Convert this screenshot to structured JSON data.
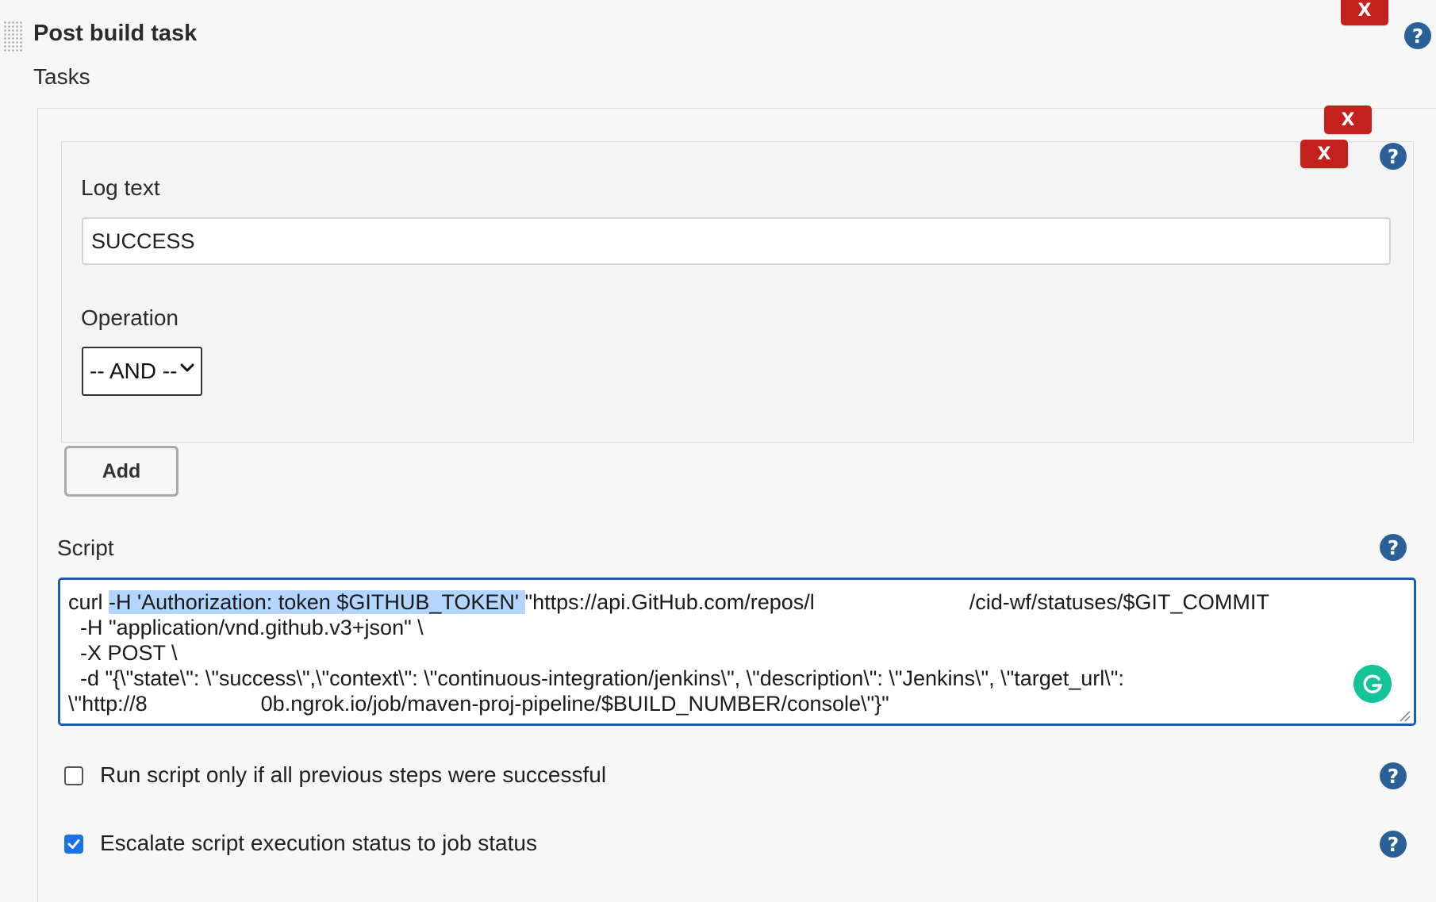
{
  "section": {
    "title": "Post build task",
    "tasks_label": "Tasks"
  },
  "delete_label": "X",
  "help_symbol": "?",
  "log_text": {
    "label": "Log text",
    "value": "SUCCESS"
  },
  "operation": {
    "label": "Operation",
    "selected": "-- AND --"
  },
  "add_button": "Add",
  "script": {
    "label": "Script",
    "line1_prefix": "curl ",
    "line1_selected": "-H 'Authorization: token $GITHUB_TOKEN' ",
    "line1_middle": "\"https://api.GitHub.com/repos/l",
    "line1_suffix": "/cid-wf/statuses/$GIT_COMMIT",
    "line2": "  -H \"application/vnd.github.v3+json\" \\",
    "line3": "  -X POST \\",
    "line4": "  -d \"{\\\"state\\\": \\\"success\\\",\\\"context\\\": \\\"continuous-integration/jenkins\\\", \\\"description\\\": \\\"Jenkins\\\", \\\"target_url\\\":",
    "line5_prefix": "\\\"http://8",
    "line5_suffix": "0b.ngrok.io/job/maven-proj-pipeline/$BUILD_NUMBER/console\\\"}\""
  },
  "options": {
    "run_only_if_success": {
      "label": "Run script only if all previous steps were successful",
      "checked": false
    },
    "escalate_status": {
      "label": "Escalate script execution status to job status",
      "checked": true
    }
  },
  "colors": {
    "delete_red": "#c4201c",
    "help_blue": "#2a5f98",
    "focus_blue": "#1f5bb5",
    "selection": "#b4d5fe",
    "grammarly_green": "#15c39a",
    "checkbox_blue": "#1a73e8"
  },
  "icons": [
    "drag-handle-icon",
    "close-icon",
    "help-icon",
    "chevron-down-icon",
    "grammarly-icon",
    "resize-grip-icon",
    "checkmark-icon"
  ]
}
